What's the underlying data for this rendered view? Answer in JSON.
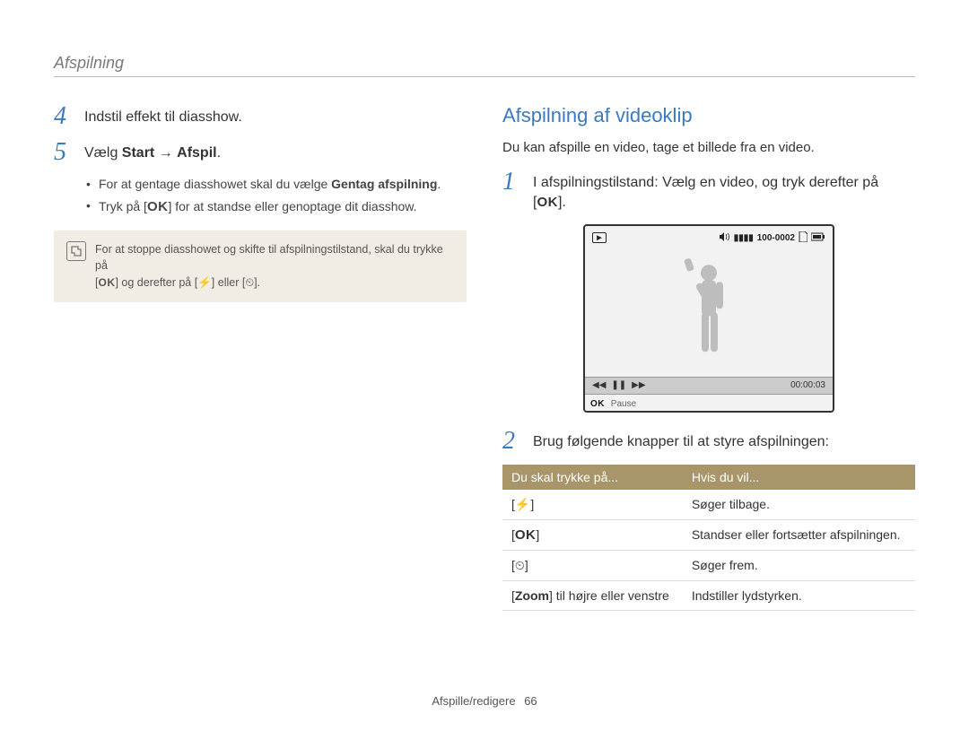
{
  "section_header": "Afspilning",
  "left": {
    "step4": {
      "num": "4",
      "text": "Indstil effekt til diasshow."
    },
    "step5": {
      "num": "5",
      "prefix": "Vælg ",
      "bold_a": "Start",
      "arrow": " → ",
      "bold_b": "Afspil",
      "suffix": "."
    },
    "bullets": [
      {
        "prefix": "For at gentage diasshowet skal du vælge ",
        "bold": "Gentag afspilning",
        "suffix": "."
      },
      {
        "prefix": "Tryk på [",
        "icon_label": "OK",
        "suffix": "] for at standse eller genoptage dit diasshow."
      }
    ],
    "note": {
      "line1_a": "For at stoppe diasshowet og skifte til afspilningstilstand, skal du trykke på",
      "line2_a": "[",
      "ok": "OK",
      "line2_b": "] og derefter på [",
      "lightning": "⚡",
      "line2_c": "] eller [",
      "timer": "⏲",
      "line2_d": "]."
    }
  },
  "right": {
    "heading": "Afspilning af videoklip",
    "intro": "Du kan afspille en video, tage et billede fra en video.",
    "step1": {
      "num": "1",
      "text_a": "I afspilningstilstand: Vælg en video, og tryk derefter på [",
      "ok": "OK",
      "text_b": "]."
    },
    "screen": {
      "top_left_info": "",
      "top_right_info": "100-0002",
      "time": "00:00:03",
      "bottom_label_ok": "OK",
      "bottom_label_text": "Pause"
    },
    "step2": {
      "num": "2",
      "text": "Brug følgende knapper til at styre afspilningen:"
    },
    "table": {
      "headers": [
        "Du skal trykke på...",
        "Hvis du vil..."
      ],
      "rows": [
        {
          "key_glyph": "⚡",
          "brackets": true,
          "desc": "Søger tilbage."
        },
        {
          "key_text": "OK",
          "brackets": true,
          "desc": "Standser eller fortsætter afspilningen."
        },
        {
          "key_glyph": "⏲",
          "brackets": true,
          "desc": "Søger frem."
        },
        {
          "key_rich_a": "[",
          "key_bold": "Zoom",
          "key_rich_b": "] til højre eller venstre",
          "desc": "Indstiller lydstyrken."
        }
      ]
    }
  },
  "footer": {
    "text": "Afspille/redigere",
    "page": "66"
  }
}
